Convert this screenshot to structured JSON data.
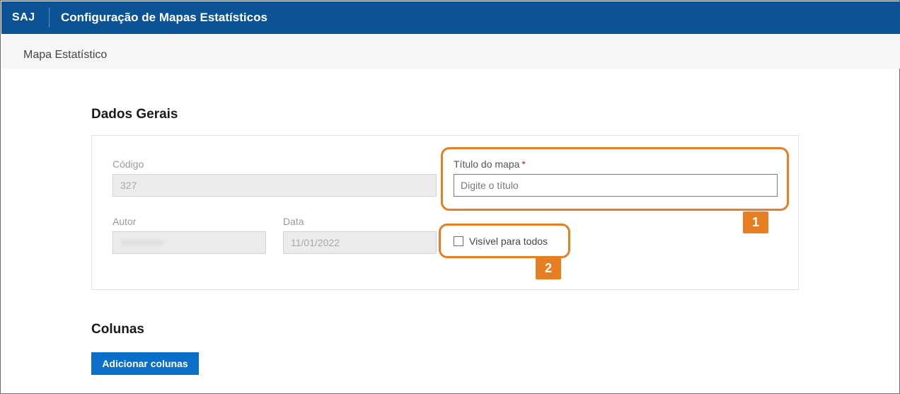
{
  "header": {
    "brand": "SAJ",
    "title": "Configuração de Mapas Estatísticos"
  },
  "breadcrumb": "Mapa Estatístico",
  "sections": {
    "general": "Dados Gerais",
    "columns": "Colunas"
  },
  "form": {
    "code_label": "Código",
    "code_value": "327",
    "author_label": "Autor",
    "author_value": "",
    "date_label": "Data",
    "date_value": "11/01/2022",
    "title_label": "Título do mapa",
    "title_required_mark": "*",
    "title_placeholder": "Digite o título",
    "title_value": "",
    "visible_label": "Visível para todos",
    "visible_checked": false
  },
  "buttons": {
    "add_columns": "Adicionar colunas"
  },
  "callouts": {
    "one": "1",
    "two": "2"
  },
  "colors": {
    "header_bg": "#0b5394",
    "button_bg": "#0b6fc7",
    "callout": "#e67e22",
    "required": "#c0192c"
  }
}
